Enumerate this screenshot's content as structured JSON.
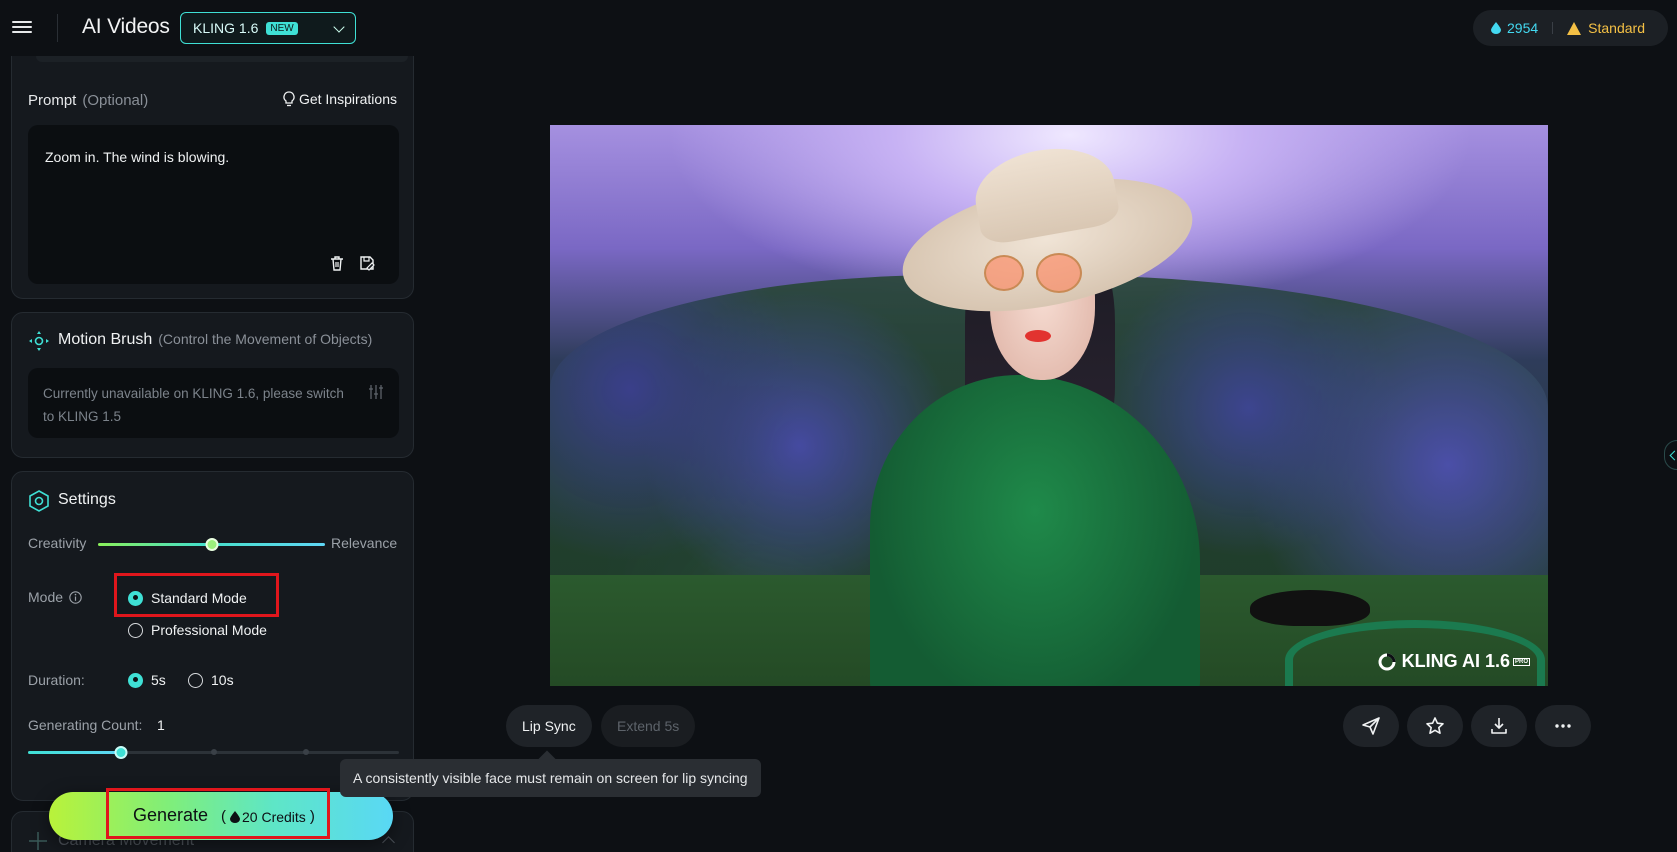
{
  "header": {
    "app_title": "AI Videos",
    "model_name": "KLING 1.6",
    "model_badge": "NEW",
    "credits": "2954",
    "plan": "Standard"
  },
  "prompt": {
    "label": "Prompt",
    "optional": "(Optional)",
    "inspirations": "Get Inspirations",
    "text": "Zoom in. The wind is blowing."
  },
  "motion_brush": {
    "title": "Motion Brush",
    "subtitle": "(Control the Movement of Objects)",
    "note": "Currently unavailable on KLING 1.6, please switch to KLING 1.5"
  },
  "settings": {
    "title": "Settings",
    "creativity_label": "Creativity",
    "relevance_label": "Relevance",
    "creativity_value": 0.5,
    "mode_label": "Mode",
    "mode_options": [
      "Standard Mode",
      "Professional Mode"
    ],
    "mode_selected": "Standard Mode",
    "duration_label": "Duration:",
    "duration_options": [
      "5s",
      "10s"
    ],
    "duration_selected": "5s",
    "generating_count_label": "Generating Count:",
    "generating_count_value": "1",
    "generating_count_position": 0.25
  },
  "camera": {
    "title": "Camera Movement"
  },
  "generate": {
    "label": "Generate",
    "credits_text": "20 Credits"
  },
  "preview": {
    "watermark": "KLING AI 1.6",
    "watermark_badge": "PRO",
    "lip_sync": "Lip Sync",
    "extend": "Extend 5s",
    "tooltip": "A consistently visible face must remain on screen for lip syncing"
  },
  "colors": {
    "accent": "#3fe0d5",
    "background": "#0d1014",
    "highlight": "#e0161c",
    "plan": "#f4c045",
    "credits": "#43d8f0"
  }
}
